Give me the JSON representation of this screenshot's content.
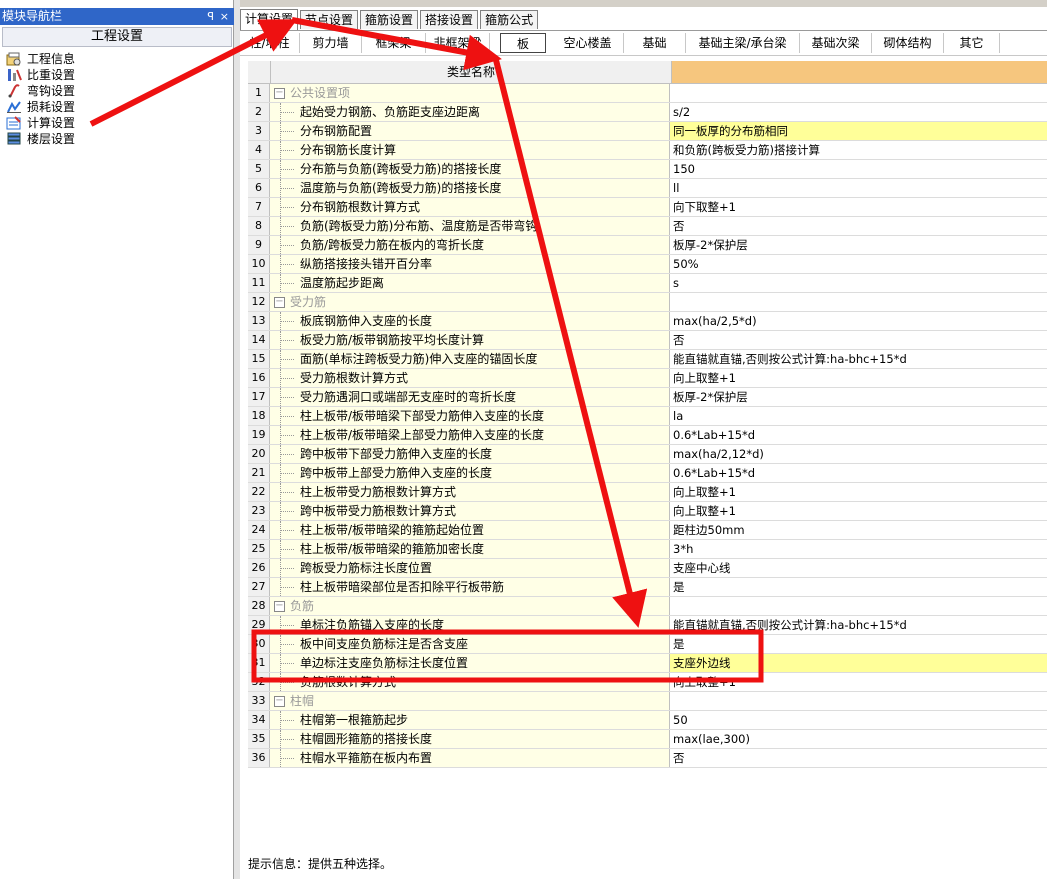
{
  "nav": {
    "title": "模块导航栏",
    "pin": "ꟼ",
    "close": "×",
    "header": "工程设置",
    "items": [
      {
        "label": "工程信息",
        "icon": "project-info-icon"
      },
      {
        "label": "比重设置",
        "icon": "weight-icon"
      },
      {
        "label": "弯钩设置",
        "icon": "hook-icon"
      },
      {
        "label": "损耗设置",
        "icon": "loss-icon"
      },
      {
        "label": "计算设置",
        "icon": "calc-settings-icon"
      },
      {
        "label": "楼层设置",
        "icon": "floor-icon"
      }
    ]
  },
  "tabs": [
    "计算设置",
    "节点设置",
    "箍筋设置",
    "搭接设置",
    "箍筋公式"
  ],
  "active_tab": 0,
  "subtabs": [
    "柱/墙柱",
    "剪力墙",
    "框架梁",
    "非框架梁",
    "板",
    "空心楼盖",
    "基础",
    "基础主梁/承台梁",
    "基础次梁",
    "砌体结构",
    "其它"
  ],
  "active_subtab": 4,
  "grid": {
    "header_name": "类型名称",
    "rows": [
      {
        "n": "1",
        "type": "group",
        "name": "公共设置项",
        "value": ""
      },
      {
        "n": "2",
        "type": "item",
        "name": "起始受力钢筋、负筋距支座边距离",
        "value": "s/2"
      },
      {
        "n": "3",
        "type": "item",
        "name": "分布钢筋配置",
        "value": "同一板厚的分布筋相同",
        "hl": true
      },
      {
        "n": "4",
        "type": "item",
        "name": "分布钢筋长度计算",
        "value": "和负筋(跨板受力筋)搭接计算"
      },
      {
        "n": "5",
        "type": "item",
        "name": "分布筋与负筋(跨板受力筋)的搭接长度",
        "value": "150"
      },
      {
        "n": "6",
        "type": "item",
        "name": "温度筋与负筋(跨板受力筋)的搭接长度",
        "value": "ll"
      },
      {
        "n": "7",
        "type": "item",
        "name": "分布钢筋根数计算方式",
        "value": "向下取整+1"
      },
      {
        "n": "8",
        "type": "item",
        "name": "负筋(跨板受力筋)分布筋、温度筋是否带弯钩",
        "value": "否"
      },
      {
        "n": "9",
        "type": "item",
        "name": "负筋/跨板受力筋在板内的弯折长度",
        "value": "板厚-2*保护层"
      },
      {
        "n": "10",
        "type": "item",
        "name": "纵筋搭接接头错开百分率",
        "value": "50%"
      },
      {
        "n": "11",
        "type": "item",
        "name": "温度筋起步距离",
        "value": "s"
      },
      {
        "n": "12",
        "type": "group",
        "name": "受力筋",
        "value": ""
      },
      {
        "n": "13",
        "type": "item",
        "name": "板底钢筋伸入支座的长度",
        "value": "max(ha/2,5*d)"
      },
      {
        "n": "14",
        "type": "item",
        "name": "板受力筋/板带钢筋按平均长度计算",
        "value": "否"
      },
      {
        "n": "15",
        "type": "item",
        "name": "面筋(单标注跨板受力筋)伸入支座的锚固长度",
        "value": "能直锚就直锚,否则按公式计算:ha-bhc+15*d"
      },
      {
        "n": "16",
        "type": "item",
        "name": "受力筋根数计算方式",
        "value": "向上取整+1"
      },
      {
        "n": "17",
        "type": "item",
        "name": "受力筋遇洞口或端部无支座时的弯折长度",
        "value": "板厚-2*保护层"
      },
      {
        "n": "18",
        "type": "item",
        "name": "柱上板带/板带暗梁下部受力筋伸入支座的长度",
        "value": "la"
      },
      {
        "n": "19",
        "type": "item",
        "name": "柱上板带/板带暗梁上部受力筋伸入支座的长度",
        "value": "0.6*Lab+15*d"
      },
      {
        "n": "20",
        "type": "item",
        "name": "跨中板带下部受力筋伸入支座的长度",
        "value": "max(ha/2,12*d)"
      },
      {
        "n": "21",
        "type": "item",
        "name": "跨中板带上部受力筋伸入支座的长度",
        "value": "0.6*Lab+15*d"
      },
      {
        "n": "22",
        "type": "item",
        "name": "柱上板带受力筋根数计算方式",
        "value": "向上取整+1"
      },
      {
        "n": "23",
        "type": "item",
        "name": "跨中板带受力筋根数计算方式",
        "value": "向上取整+1"
      },
      {
        "n": "24",
        "type": "item",
        "name": "柱上板带/板带暗梁的箍筋起始位置",
        "value": "距柱边50mm"
      },
      {
        "n": "25",
        "type": "item",
        "name": "柱上板带/板带暗梁的箍筋加密长度",
        "value": "3*h"
      },
      {
        "n": "26",
        "type": "item",
        "name": "跨板受力筋标注长度位置",
        "value": "支座中心线"
      },
      {
        "n": "27",
        "type": "item",
        "name": "柱上板带暗梁部位是否扣除平行板带筋",
        "value": "是"
      },
      {
        "n": "28",
        "type": "group",
        "name": "负筋",
        "value": ""
      },
      {
        "n": "29",
        "type": "item",
        "name": "单标注负筋锚入支座的长度",
        "value": "能直锚就直锚,否则按公式计算:ha-bhc+15*d"
      },
      {
        "n": "30",
        "type": "item",
        "name": "板中间支座负筋标注是否含支座",
        "value": "是"
      },
      {
        "n": "31",
        "type": "item",
        "name": "单边标注支座负筋标注长度位置",
        "value": "支座外边线",
        "hl": true
      },
      {
        "n": "32",
        "type": "item",
        "name": "负筋根数计算方式",
        "value": "向上取整+1"
      },
      {
        "n": "33",
        "type": "group",
        "name": "柱帽",
        "value": ""
      },
      {
        "n": "34",
        "type": "item",
        "name": "柱帽第一根箍筋起步",
        "value": "50"
      },
      {
        "n": "35",
        "type": "item",
        "name": "柱帽圆形箍筋的搭接长度",
        "value": "max(lae,300)"
      },
      {
        "n": "36",
        "type": "item",
        "name": "柱帽水平箍筋在板内布置",
        "value": "否"
      }
    ]
  },
  "status": "提示信息：提供五种选择。",
  "colors": {
    "nav_title_bg": "#2f66c8",
    "value_header": "#f6c67e",
    "name_cell": "#ffffe6",
    "highlight": "#ffff99",
    "annotation": "#ee1111"
  }
}
